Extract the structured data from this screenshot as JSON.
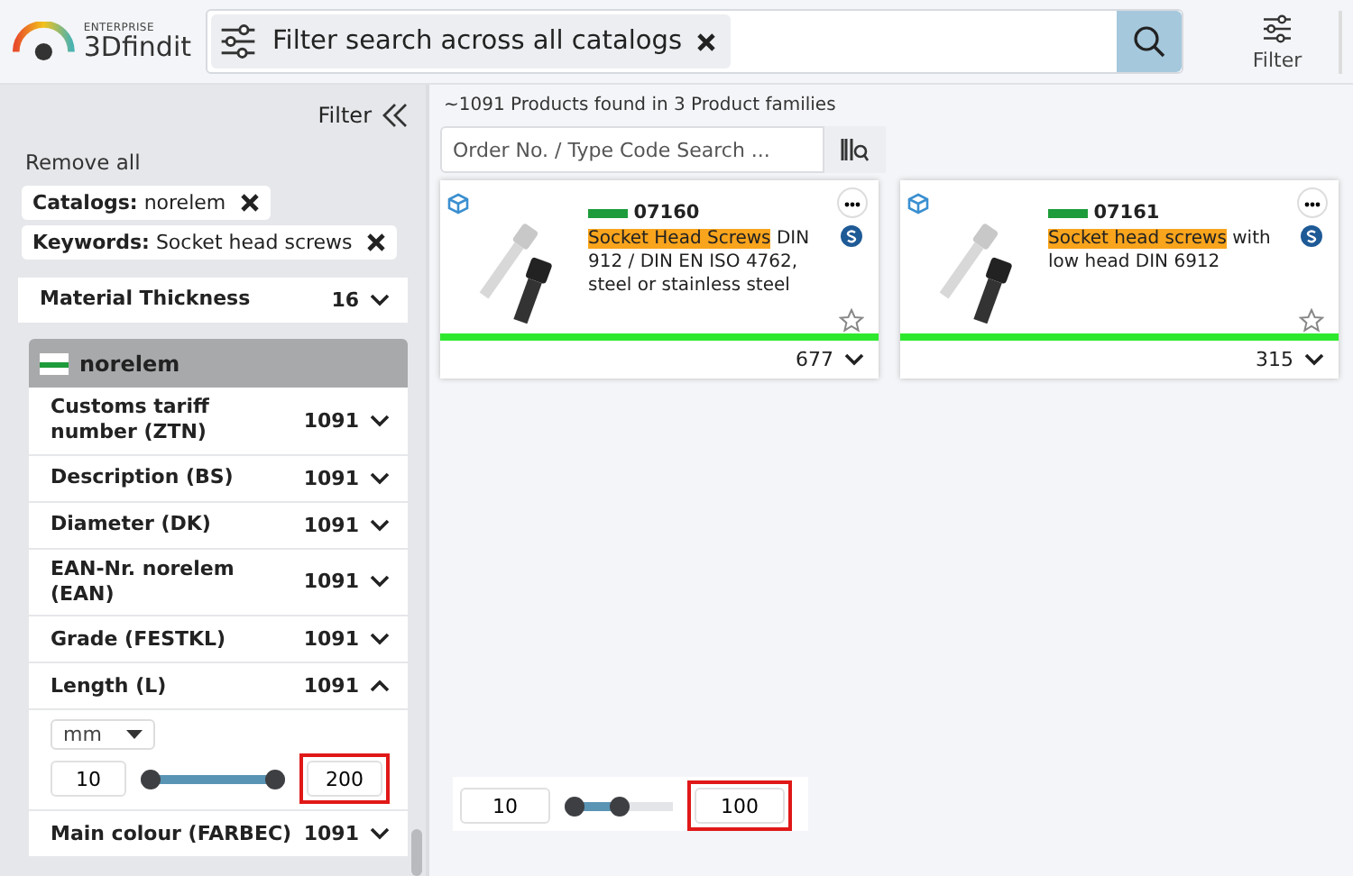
{
  "header": {
    "logo_small": "ENTERPRISE",
    "logo_brand": "3Dfindit",
    "search_chip": "Filter search across all catalogs",
    "filter_label": "Filter"
  },
  "sidebar": {
    "title": "Filter",
    "remove_all": "Remove all",
    "chips": [
      {
        "key": "Catalogs:",
        "value": "norelem"
      },
      {
        "key": "Keywords:",
        "value": "Socket head screws"
      }
    ],
    "top_rows": [
      {
        "label": "Material Thickness",
        "count": "16",
        "expanded": false
      }
    ],
    "group": {
      "name": "norelem",
      "rows": [
        {
          "label": "Customs tariff number (ZTN)",
          "count": "1091",
          "expanded": false
        },
        {
          "label": "Description (BS)",
          "count": "1091",
          "expanded": false
        },
        {
          "label": "Diameter (DK)",
          "count": "1091",
          "expanded": false
        },
        {
          "label": "EAN-Nr. norelem (EAN)",
          "count": "1091",
          "expanded": false
        },
        {
          "label": "Grade (FESTKL)",
          "count": "1091",
          "expanded": false
        },
        {
          "label": "Length (L)",
          "count": "1091",
          "expanded": true,
          "unit": "mm",
          "slider": {
            "min": "10",
            "max": "200",
            "level": 1,
            "highlighted": true
          }
        },
        {
          "label": "Main colour (FARBEC)",
          "count": "1091",
          "expanded": false
        }
      ]
    }
  },
  "results": {
    "summary": "~1091 Products found in 3 Product families",
    "search_placeholder": "Order No. / Type Code Search ...",
    "products": [
      {
        "code": "07160",
        "highlight": "Socket Head Screws",
        "description": " DIN 912 / DIN EN ISO 4762, steel or stainless steel",
        "count": "677"
      },
      {
        "code": "07161",
        "highlight": "Socket head screws",
        "description": " with low head DIN 6912",
        "count": "315"
      }
    ]
  },
  "floating_slider": {
    "min": "10",
    "max": "100",
    "level": 0.5,
    "highlighted": true
  }
}
